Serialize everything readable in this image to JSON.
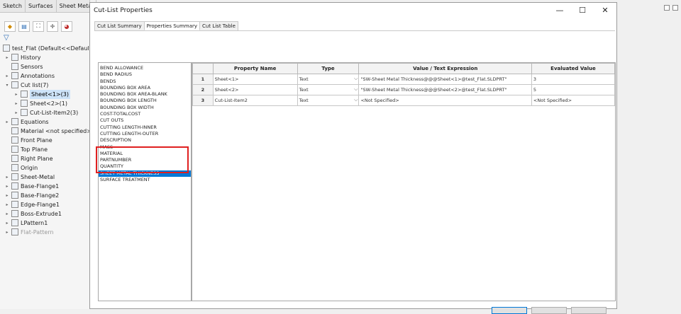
{
  "left_panel": {
    "tabs": [
      "Sketch",
      "Surfaces",
      "Sheet Metal"
    ],
    "tree": [
      {
        "label": "test_Flat  (Default<<Default>_",
        "icon": "part-icon",
        "indent": 0,
        "arrow": ""
      },
      {
        "label": "History",
        "icon": "history-icon",
        "indent": 1,
        "arrow": "▸"
      },
      {
        "label": "Sensors",
        "icon": "sensors-icon",
        "indent": 1,
        "arrow": ""
      },
      {
        "label": "Annotations",
        "icon": "annotations-icon",
        "indent": 1,
        "arrow": "▸"
      },
      {
        "label": "Cut list(7)",
        "icon": "cut-list-icon",
        "indent": 1,
        "arrow": "▾"
      },
      {
        "label": "Sheet<1>(3)",
        "icon": "sheet-icon",
        "indent": 2,
        "arrow": "▸",
        "selected": true
      },
      {
        "label": "Sheet<2>(1)",
        "icon": "sheet-icon",
        "indent": 2,
        "arrow": "▸"
      },
      {
        "label": "Cut-List-Item2(3)",
        "icon": "folder-icon",
        "indent": 2,
        "arrow": "▸"
      },
      {
        "label": "Equations",
        "icon": "equations-icon",
        "indent": 1,
        "arrow": "▸"
      },
      {
        "label": "Material <not specified>",
        "icon": "material-icon",
        "indent": 1,
        "arrow": ""
      },
      {
        "label": "Front Plane",
        "icon": "plane-icon",
        "indent": 1,
        "arrow": ""
      },
      {
        "label": "Top Plane",
        "icon": "plane-icon",
        "indent": 1,
        "arrow": ""
      },
      {
        "label": "Right Plane",
        "icon": "plane-icon",
        "indent": 1,
        "arrow": ""
      },
      {
        "label": "Origin",
        "icon": "origin-icon",
        "indent": 1,
        "arrow": ""
      },
      {
        "label": "Sheet-Metal",
        "icon": "sheet-metal-icon",
        "indent": 1,
        "arrow": "▸"
      },
      {
        "label": "Base-Flange1",
        "icon": "flange-icon",
        "indent": 1,
        "arrow": "▸"
      },
      {
        "label": "Base-Flange2",
        "icon": "flange-icon",
        "indent": 1,
        "arrow": "▸"
      },
      {
        "label": "Edge-Flange1",
        "icon": "edge-flange-icon",
        "indent": 1,
        "arrow": "▸"
      },
      {
        "label": "Boss-Extrude1",
        "icon": "extrude-icon",
        "indent": 1,
        "arrow": "▸"
      },
      {
        "label": "LPattern1",
        "icon": "pattern-icon",
        "indent": 1,
        "arrow": "▸"
      },
      {
        "label": "Flat-Pattern",
        "icon": "flat-pattern-icon",
        "indent": 1,
        "arrow": "▸",
        "grey": true
      }
    ]
  },
  "dialog": {
    "title": "Cut-List Properties",
    "minimize": "—",
    "maximize": "☐",
    "close": "✕",
    "tabs": [
      {
        "label": "Cut List Summary",
        "active": false
      },
      {
        "label": "Properties Summary",
        "active": true
      },
      {
        "label": "Cut List Table",
        "active": false
      }
    ],
    "property_list": [
      "BEND ALLOWANCE",
      "BEND RADIUS",
      "BENDS",
      "BOUNDING BOX AREA",
      "BOUNDING BOX AREA-BLANK",
      "BOUNDING BOX LENGTH",
      "BOUNDING BOX WIDTH",
      "COST-TOTALCOST",
      "CUT OUTS",
      "CUTTING LENGTH-INNER",
      "CUTTING LENGTH-OUTER",
      "DESCRIPTION",
      "MASS",
      "MATERIAL",
      "PARTNUMBER",
      "QUANTITY",
      "SHEET METAL THICKNESS",
      "SURFACE TREATMENT"
    ],
    "selected_property": "SHEET METAL THICKNESS",
    "grid": {
      "headers": [
        "Property Name",
        "Type",
        "Value / Text Expression",
        "Evaluated Value"
      ],
      "rows": [
        {
          "num": "1",
          "name": "Sheet<1>",
          "type": "Text",
          "value": "\"SW-Sheet Metal Thickness@@@Sheet<1>@test_Flat.SLDPRT\"",
          "evaluated": "3"
        },
        {
          "num": "2",
          "name": "Sheet<2>",
          "type": "Text",
          "value": "\"SW-Sheet Metal Thickness@@@Sheet<2>@test_Flat.SLDPRT\"",
          "evaluated": "5"
        },
        {
          "num": "3",
          "name": "Cut-List-Item2",
          "type": "Text",
          "value": "<Not Specified>",
          "evaluated": "<Not Specified>"
        }
      ]
    }
  },
  "colors": {
    "selection": "#0078d7",
    "highlight_box": "#e02020",
    "tree_selection": "#cde3f8"
  }
}
